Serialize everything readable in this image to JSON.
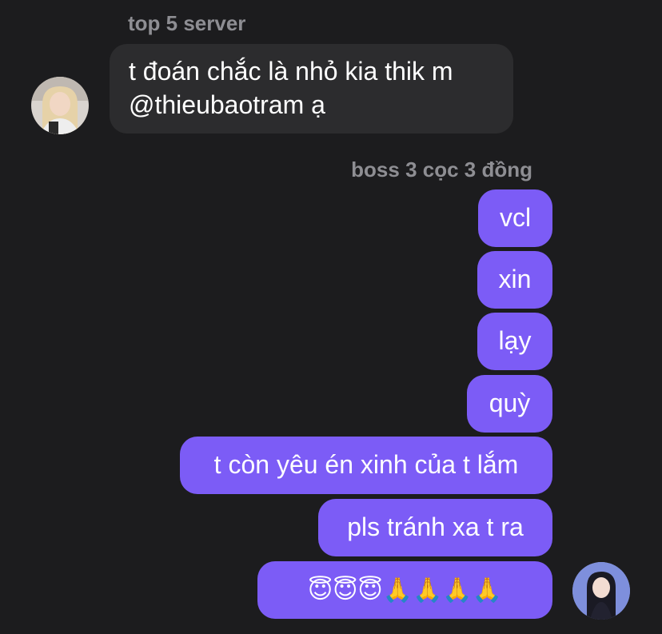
{
  "incoming": {
    "sender": "top 5 server",
    "lines": [
      "t đoán chắc là nhỏ kia thik m",
      "@thieubaotram ạ"
    ]
  },
  "outgoing": {
    "sender": "boss 3 cọc 3 đồng",
    "messages": [
      "vcl",
      "xin",
      "lạy",
      "quỳ",
      "t còn yêu én xinh của t lắm",
      "pls tránh xa t ra",
      "😇😇😇🙏🙏🙏🙏"
    ]
  },
  "colors": {
    "background": "#1c1c1e",
    "incoming_bubble": "#2c2c2e",
    "outgoing_bubble": "#7c5cf6",
    "sender_name": "#8e8e93"
  },
  "icons": {
    "incoming_avatar": "avatar-photo-girl",
    "outgoing_avatar": "avatar-photo-girl-dark-hair"
  }
}
